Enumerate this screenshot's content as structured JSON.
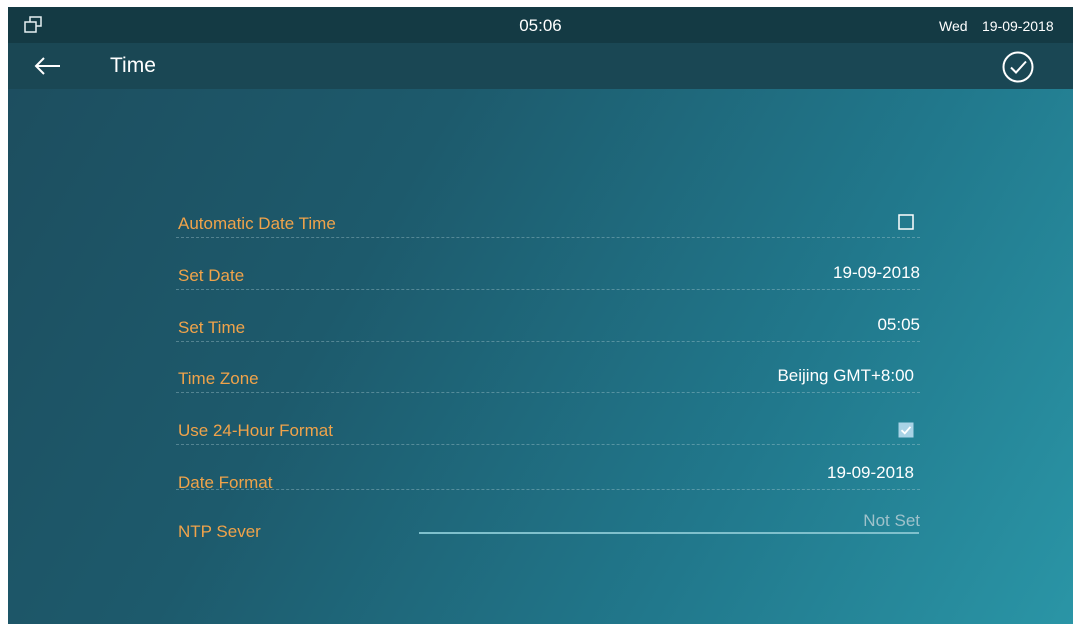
{
  "statusbar": {
    "time": "05:06",
    "day": "Wed",
    "date": "19-09-2018"
  },
  "titlebar": {
    "title": "Time"
  },
  "settings": [
    {
      "label": "Automatic Date Time",
      "type": "checkbox",
      "checked": false
    },
    {
      "label": "Set Date",
      "value": "19-09-2018"
    },
    {
      "label": "Set Time",
      "value": "05:05"
    },
    {
      "label": "Time Zone",
      "value": "Beijing GMT+8:00"
    },
    {
      "label": "Use 24-Hour Format",
      "type": "checkbox",
      "checked": true
    },
    {
      "label": "Date Format",
      "value": "19-09-2018"
    },
    {
      "label": "NTP Sever",
      "type": "input",
      "placeholder": "Not Set"
    }
  ],
  "colors": {
    "label": "#f0a34a",
    "checkbox_checked": "#a9d3e6",
    "status_bar": "#143a44"
  }
}
